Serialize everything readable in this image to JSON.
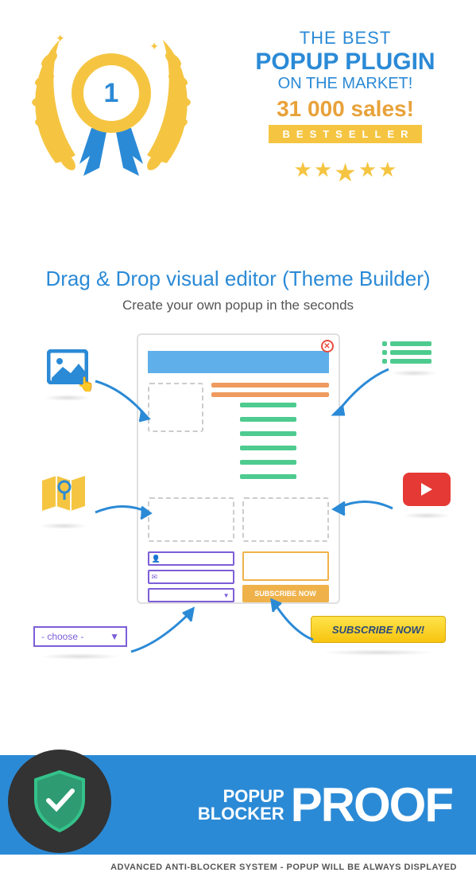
{
  "hero": {
    "rank": "1",
    "best": "THE BEST",
    "plugin": "POPUP PLUGIN",
    "market": "ON THE MARKET!",
    "sales": "31 000 sales!",
    "bestseller": "BESTSELLER"
  },
  "dragdrop": {
    "title": "Drag & Drop visual editor (Theme Builder)",
    "subtitle": "Create your own popup in the seconds",
    "subscribe_now": "SUBSCRIBE NOW",
    "choose": "- choose -",
    "subscribe_big": "SUBSCRIBE NOW!"
  },
  "proof": {
    "line1": "POPUP",
    "line2": "BLOCKER",
    "big": "PROOF",
    "anti": "ADVANCED ANTI-BLOCKER SYSTEM - POPUP WILL BE ALWAYS DISPLAYED"
  }
}
